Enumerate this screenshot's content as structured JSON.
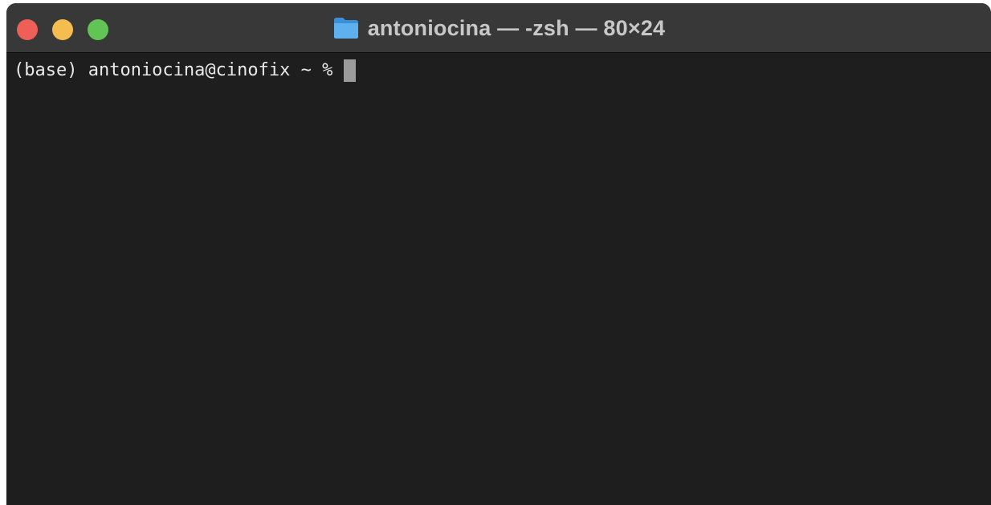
{
  "window": {
    "title": "antoniocina — -zsh — 80×24"
  },
  "title_icon": "folder-icon",
  "colors": {
    "close": "#ee5f57",
    "minimize": "#f5bd4f",
    "maximize": "#61c454",
    "titlebar": "#383838",
    "terminal_bg": "#1e1e1e",
    "text": "#e8e8e8"
  },
  "terminal": {
    "prompt": "(base) antoniocina@cinofix ~ %"
  }
}
